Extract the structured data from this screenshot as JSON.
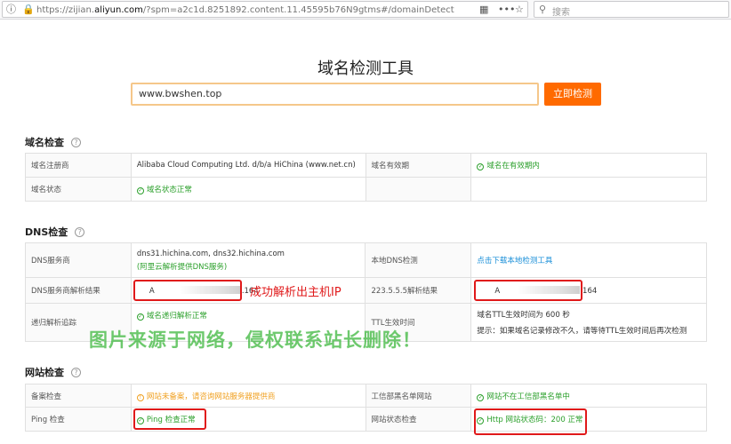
{
  "browser": {
    "url_prefix": "https://zijian.",
    "url_domain": "aliyun.com",
    "url_rest": "/?spm=a2c1d.8251892.content.11.45595b76N9gtms#/domainDetect",
    "search_placeholder": "搜索"
  },
  "page": {
    "title": "域名检测工具",
    "input_value": "www.bwshen.top",
    "check_button": "立即检测"
  },
  "domain_check": {
    "heading": "域名检查",
    "rows": [
      {
        "label1": "域名注册商",
        "value1": "Alibaba Cloud Computing Ltd. d/b/a HiChina (www.net.cn)",
        "label2": "域名有效期",
        "value2": "域名在有效期内"
      },
      {
        "label1": "域名状态",
        "value1": "域名状态正常",
        "label2": "",
        "value2": ""
      }
    ]
  },
  "dns_check": {
    "heading": "DNS检查",
    "dns_server_label": "DNS服务商",
    "dns_server_value": "dns31.hichina.com, dns32.hichina.com",
    "dns_server_note": "(阿里云解析提供DNS服务)",
    "local_dns_label": "本地DNS检测",
    "local_dns_link": "点击下载本地检测工具",
    "resolve_label": "DNS服务商解析结果",
    "resolve_type": "A",
    "resolve_ip_tail": ".164",
    "resolve2_label": "223.5.5.5解析结果",
    "resolve2_type": "A",
    "resolve2_ip_tail": ".164",
    "recursive_label": "递归解析追踪",
    "recursive_value": "域名递归解析正常",
    "ttl_label": "TTL生效时间",
    "ttl_value": "域名TTL生效时间为 600 秒",
    "ttl_tip": "提示：如果域名记录修改不久，请等待TTL生效时间后再次检测"
  },
  "site_check": {
    "heading": "网站检查",
    "beian_label": "备案检查",
    "beian_value": "网站未备案，请咨询网站服务器提供商",
    "blacklist_label": "工信部黑名单网站",
    "blacklist_value": "网站不在工信部黑名单中",
    "ping_label": "Ping 检查",
    "ping_value": "Ping 检查正常",
    "status_label": "网站状态检查",
    "status_value": "Http 网站状态码：200 正常"
  },
  "annotations": {
    "success_note": "成功解析出主机IP",
    "watermark": "图片来源于网络，侵权联系站长删除！"
  },
  "colors": {
    "accent": "#ff6a00",
    "ok": "#2ca02c",
    "warn": "#f0a020",
    "link": "#1a8fd8",
    "highlight": "#e0191a"
  }
}
